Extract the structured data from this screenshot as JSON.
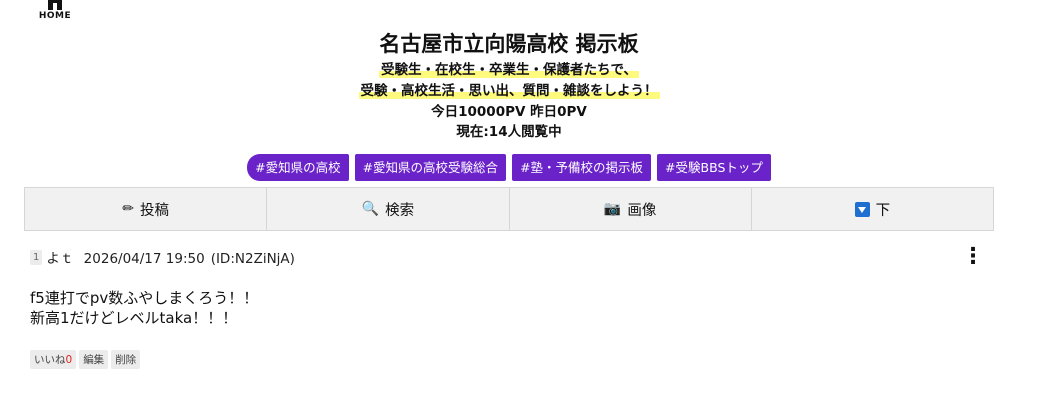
{
  "home": {
    "label": "HOME"
  },
  "header": {
    "title": "名古屋市立向陽高校 掲示板",
    "tagline_1": "受験生・在校生・卒業生・保護者たちで、",
    "tagline_2": "受験・高校生活・思い出、質問・雑談をしよう！",
    "views": "今日10000PV 昨日0PV",
    "online": "現在:14人閲覧中"
  },
  "tags": [
    "#愛知県の高校",
    "#愛知県の高校受験総合",
    "#塾・予備校の掲示板",
    "#受験BBSトップ"
  ],
  "toolbar": {
    "post": "投稿",
    "search": "検索",
    "image": "画像",
    "down": "下"
  },
  "post": {
    "number": "1",
    "author": "よｔ",
    "date": "2026/04/17 19:50",
    "id": "(ID:N2ZiNjA)",
    "line_1": "f5連打でpv数ふやしまくろう！！",
    "line_2": "新高1だけどレベルtaka！！！",
    "like_label": "いいね",
    "like_count": "0",
    "edit": "編集",
    "delete": "削除"
  },
  "colors": {
    "tag_bg": "#6a22c9",
    "highlight": "#fdfa7d",
    "toolbar_bg": "#f1f1f1"
  }
}
